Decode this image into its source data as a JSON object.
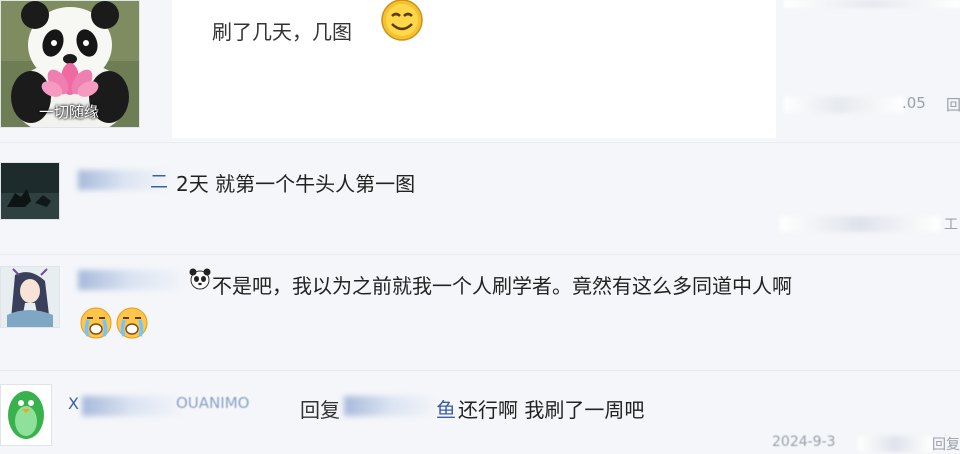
{
  "post_main": {
    "avatar_caption": "一切随缘",
    "text": "刷了几天，几图",
    "emoji": "smiley-face-icon",
    "reply_glyph": "回",
    "time_fragment": ".05"
  },
  "replies": [
    {
      "username_fragment": "二",
      "text": "2天 就第一个牛头人第一图",
      "time_suffix": "工",
      "avatar": "dark-fox-avatar"
    },
    {
      "text": "不是吧，我以为之前就我一个人刷学者。竟然有这么多同道中人啊",
      "emojis": [
        "crying-face-icon",
        "crying-face-icon"
      ],
      "avatar": "girl-anime-avatar"
    },
    {
      "username_fragment": "X",
      "username_mid": "OUANIMO",
      "reply_word": "回复",
      "reply_target_fragment": "鱼",
      "text": "还行啊 我刷了一周吧",
      "time_text": "2024-9-3",
      "time_suffix": "回复",
      "avatar": "green-penguin-avatar"
    }
  ]
}
